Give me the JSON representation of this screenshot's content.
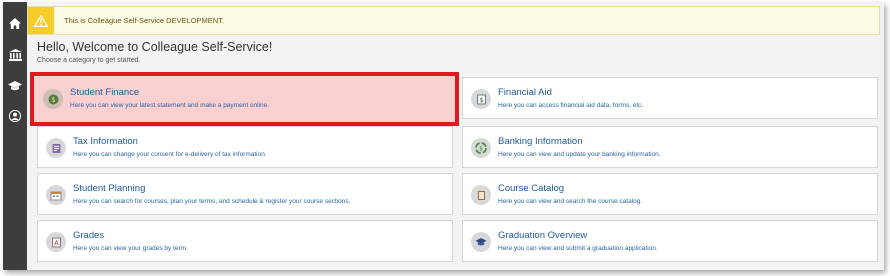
{
  "sidebar": {
    "items": [
      {
        "icon": "home-icon"
      },
      {
        "icon": "bank-icon"
      },
      {
        "icon": "graduation-cap-icon"
      },
      {
        "icon": "user-icon"
      }
    ]
  },
  "banner": {
    "text": "This is Colleague Self-Service DEVELOPMENT.",
    "icon": "warning-icon",
    "color": "#f5ce2b"
  },
  "welcome": {
    "title": "Hello, Welcome to Colleague Self-Service!",
    "subtitle": "Choose a category to get started."
  },
  "cards": [
    {
      "title": "Student Finance",
      "desc": "Here you can view your latest statement and make a payment online.",
      "icon": "money-icon",
      "highlighted": true
    },
    {
      "title": "Financial Aid",
      "desc": "Here you can access financial aid data, forms, etc.",
      "icon": "financial-aid-icon"
    },
    {
      "title": "Tax Information",
      "desc": "Here you can change your consent for e-delivery of tax information.",
      "icon": "tax-form-icon"
    },
    {
      "title": "Banking Information",
      "desc": "Here you can view and update your banking information.",
      "icon": "banking-icon"
    },
    {
      "title": "Student Planning",
      "desc": "Here you can search for courses, plan your terms, and schedule & register your course sections.",
      "icon": "planning-icon"
    },
    {
      "title": "Course Catalog",
      "desc": "Here you can view and search the course catalog.",
      "icon": "catalog-icon"
    },
    {
      "title": "Grades",
      "desc": "Here you can view your grades by term.",
      "icon": "grades-icon"
    },
    {
      "title": "Graduation Overview",
      "desc": "Here you can view and submit a graduation application.",
      "icon": "graduation-icon"
    }
  ],
  "colors": {
    "highlight_border": "#e0191f",
    "highlight_fill": "#f8d0d0",
    "link": "#1f5a98",
    "sidebar": "#3d3d3d"
  }
}
